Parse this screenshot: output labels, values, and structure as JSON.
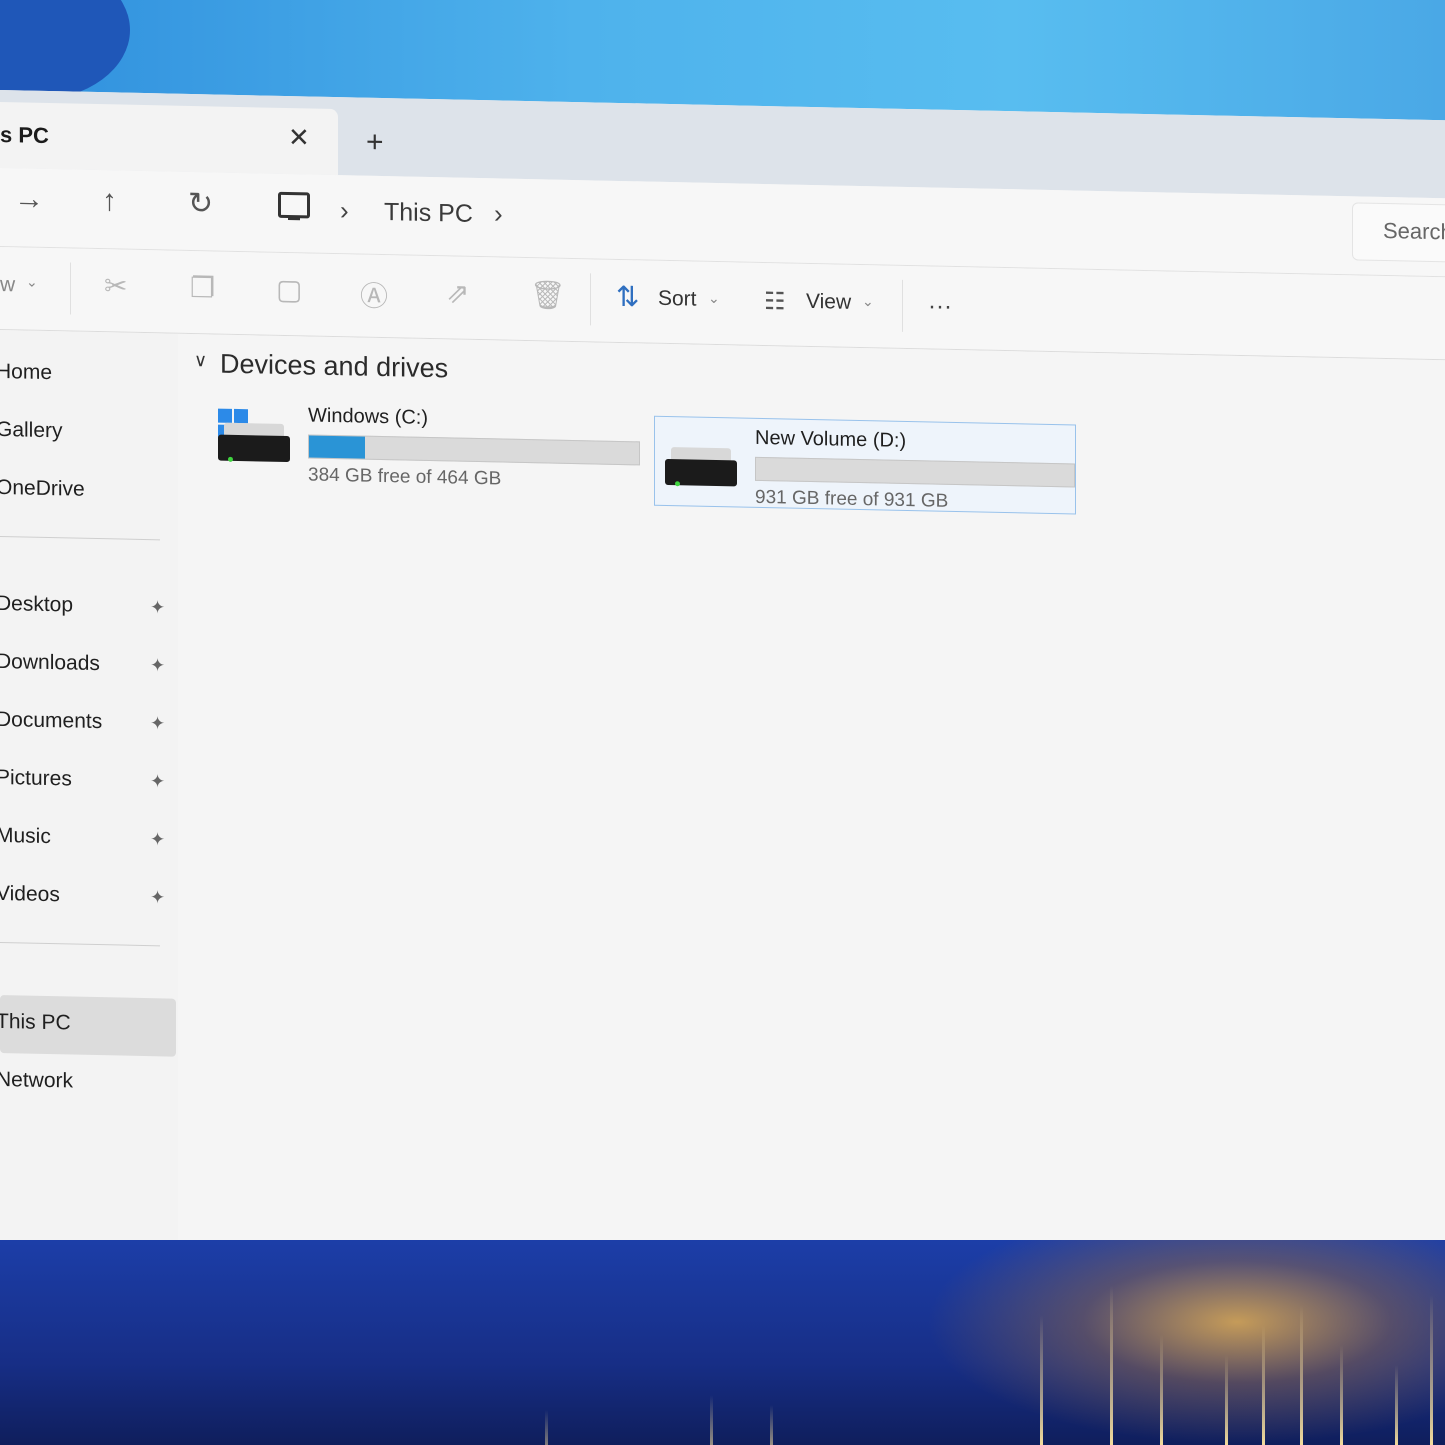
{
  "tab": {
    "title": "s PC",
    "close_glyph": "✕",
    "new_tab_glyph": "+"
  },
  "nav": {
    "forward_glyph": "→",
    "up_glyph": "↑",
    "refresh_glyph": "↻",
    "breadcrumb_sep": "›",
    "breadcrumb": "This PC",
    "search_placeholder": "Search"
  },
  "toolbar": {
    "new_label": "w",
    "sort_label": "Sort",
    "view_label": "View",
    "more_glyph": "···",
    "chevron_glyph": "⌄",
    "accent_color": "#2f6fc0"
  },
  "sidebar": {
    "items": [
      {
        "label": "Home"
      },
      {
        "label": "Gallery"
      },
      {
        "label": "OneDrive"
      },
      {
        "label": "Desktop",
        "pinned": true
      },
      {
        "label": "Downloads",
        "pinned": true
      },
      {
        "label": "Documents",
        "pinned": true
      },
      {
        "label": "Pictures",
        "pinned": true
      },
      {
        "label": "Music",
        "pinned": true
      },
      {
        "label": "Videos",
        "pinned": true
      },
      {
        "label": "This PC",
        "selected": true
      },
      {
        "label": "Network"
      }
    ],
    "pin_glyph": "📌"
  },
  "main": {
    "group_title": "Devices and drives",
    "group_chevron": "∨",
    "drives": [
      {
        "name": "Windows (C:)",
        "free_text": "384 GB free of 464 GB",
        "used_fraction": 0.17,
        "icon": "windows-drive-icon"
      },
      {
        "name": "New Volume (D:)",
        "free_text": "931 GB free of 931 GB",
        "used_fraction": 0.0,
        "icon": "drive-icon",
        "selected": true
      }
    ]
  },
  "colors": {
    "selection_border": "#99c2eb",
    "bar_fill": "#2a94d6",
    "window_bg": "#f3f3f3"
  }
}
